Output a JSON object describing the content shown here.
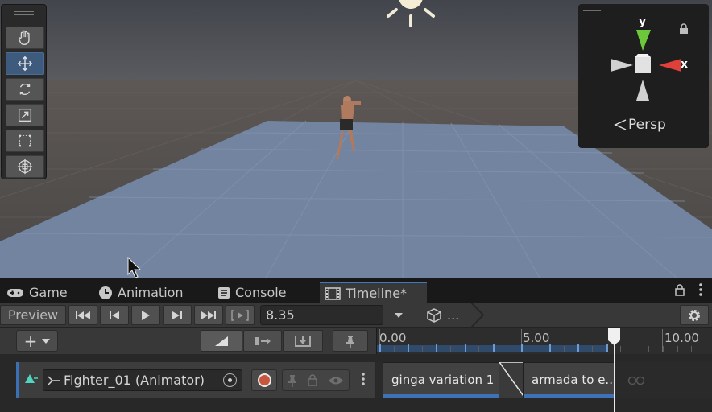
{
  "scene": {
    "tools": [
      "hand-tool",
      "move-tool",
      "rotate-tool",
      "scale-tool",
      "rect-tool",
      "transform-tool"
    ],
    "active_tool": "move-tool",
    "gizmo": {
      "axis_y": "y",
      "axis_x": "x",
      "projection": "Persp"
    },
    "colors": {
      "sky": "#4b4e55",
      "ground": "#5e5752",
      "plane": "#7587a3",
      "axis_y": "#6cc83a",
      "axis_x": "#e0403a"
    }
  },
  "tabs": [
    {
      "label": "Game",
      "icon": "gamepad-icon"
    },
    {
      "label": "Animation",
      "icon": "clock-icon"
    },
    {
      "label": "Console",
      "icon": "console-icon"
    },
    {
      "label": "Timeline*",
      "icon": "film-icon",
      "active": true
    }
  ],
  "toolbar": {
    "preview_label": "Preview",
    "time_value": "8.35",
    "breadcrumb_label": "..."
  },
  "ruler": {
    "labels": [
      "0.00",
      "5.00",
      "10.00"
    ]
  },
  "track": {
    "binding": "Fighter_01 (Animator)",
    "clips": [
      {
        "label": "ginga variation 1"
      },
      {
        "label": "armada to e.."
      }
    ]
  },
  "playhead": {
    "time": 8.35
  }
}
